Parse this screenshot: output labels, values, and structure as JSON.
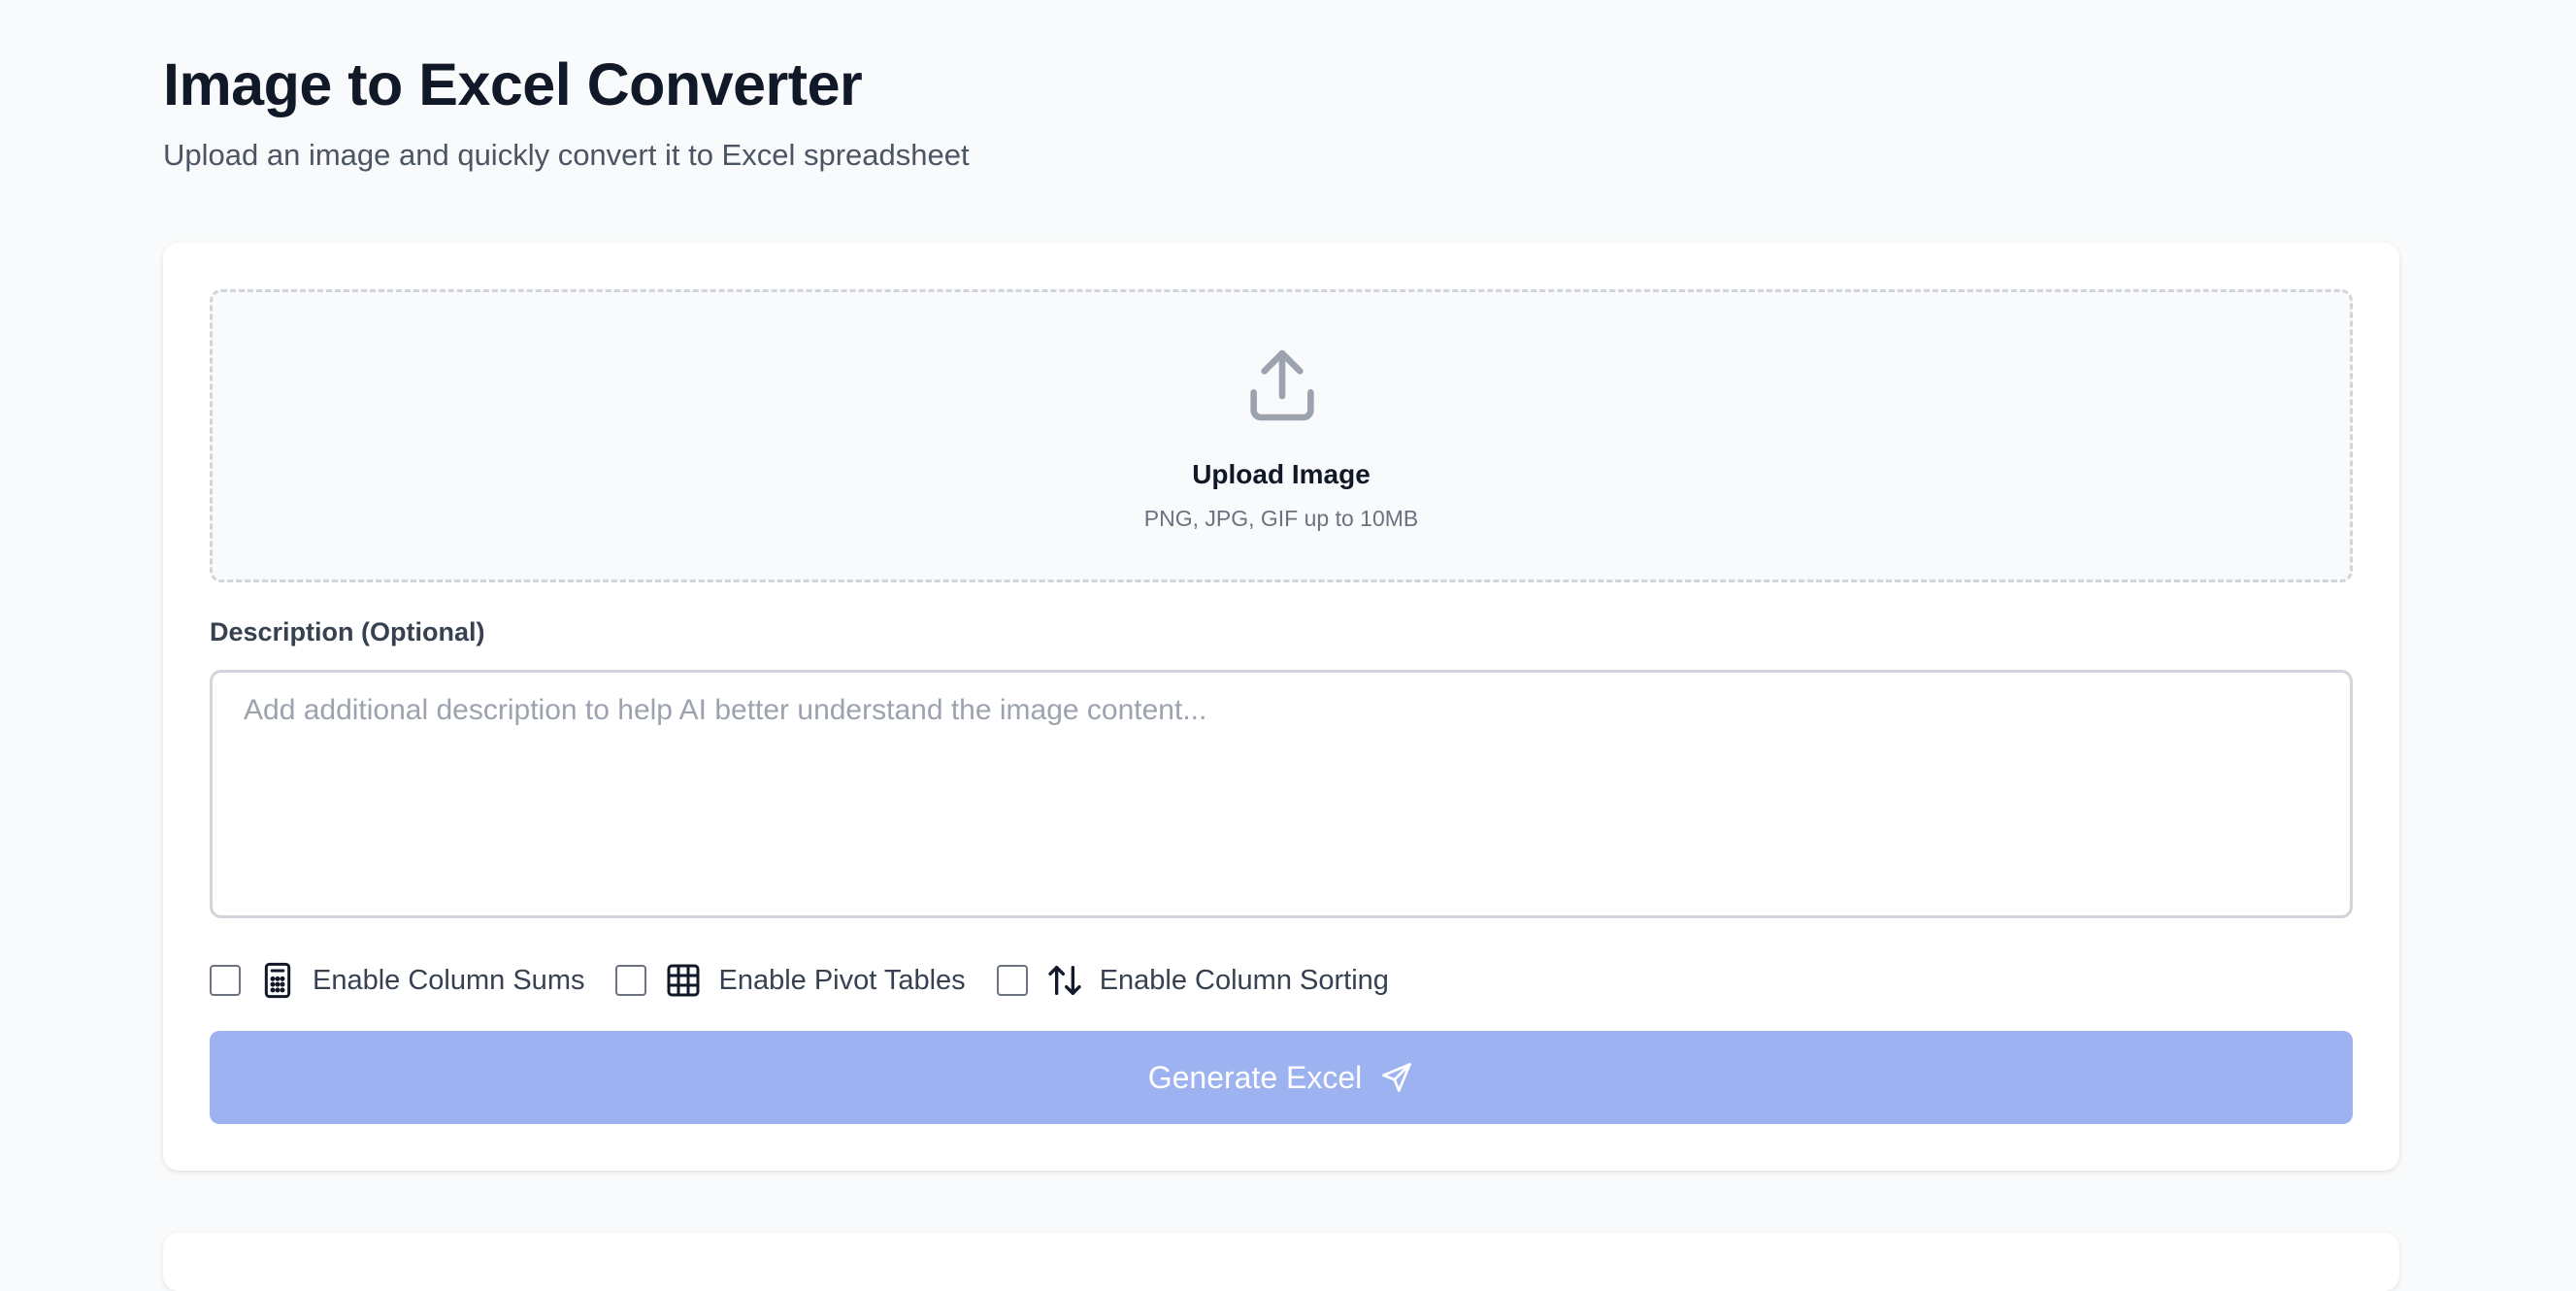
{
  "header": {
    "title": "Image to Excel Converter",
    "subtitle": "Upload an image and quickly convert it to Excel spreadsheet"
  },
  "upload": {
    "icon": "upload-icon",
    "title": "Upload Image",
    "hint": "PNG, JPG, GIF up to 10MB"
  },
  "description": {
    "label": "Description (Optional)",
    "value": "",
    "placeholder": "Add additional description to help AI better understand the image content..."
  },
  "options": [
    {
      "label": "Enable Column Sums",
      "icon": "calculator-icon",
      "checked": false
    },
    {
      "label": "Enable Pivot Tables",
      "icon": "table-grid-icon",
      "checked": false
    },
    {
      "label": "Enable Column Sorting",
      "icon": "sort-arrows-icon",
      "checked": false
    }
  ],
  "generate": {
    "label": "Generate Excel",
    "icon": "send-icon",
    "color": "#9db2f0"
  },
  "colors": {
    "background": "#f9fafb",
    "card": "#ffffff",
    "title": "#111827",
    "muted": "#6b7280",
    "border": "#d1d5db"
  }
}
